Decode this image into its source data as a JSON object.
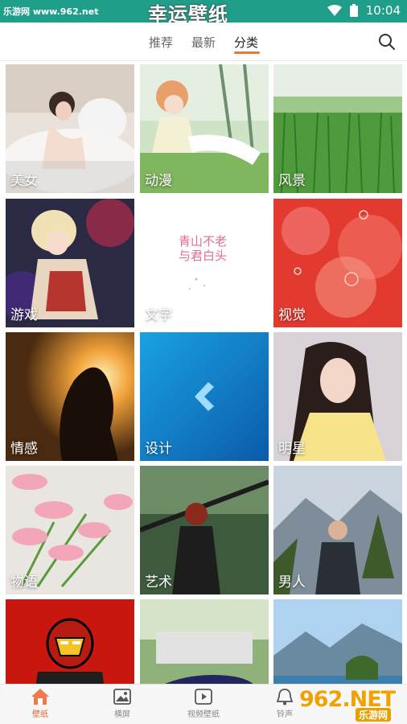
{
  "status_bar": {
    "watermark": "乐游网 www.962.net",
    "banner": "幸运壁纸",
    "time": "10:04"
  },
  "tabs": {
    "items": [
      {
        "label": "推荐"
      },
      {
        "label": "最新"
      },
      {
        "label": "分类"
      }
    ],
    "active_index": 2
  },
  "grid": {
    "categories": [
      "美女",
      "动漫",
      "风景",
      "游戏",
      "文字",
      "视觉",
      "情感",
      "设计",
      "明星",
      "物语",
      "艺术",
      "男人"
    ],
    "partial_row": [
      "",
      "",
      ""
    ],
    "text_tile_caption": [
      "青山不老",
      "与君白头"
    ]
  },
  "bottom_nav": {
    "items": [
      {
        "label": "壁纸",
        "icon": "home-icon"
      },
      {
        "label": "横屏",
        "icon": "image-icon"
      },
      {
        "label": "视频壁纸",
        "icon": "video-icon"
      },
      {
        "label": "铃声",
        "icon": "bell-icon"
      }
    ],
    "active_index": 0
  },
  "watermark_bottom": {
    "big": "962.NET",
    "small": "乐游网"
  },
  "colors": {
    "status_bar": "#1f9f8a",
    "accent": "#e8643a",
    "tab_indicator": "#e67a3c"
  }
}
